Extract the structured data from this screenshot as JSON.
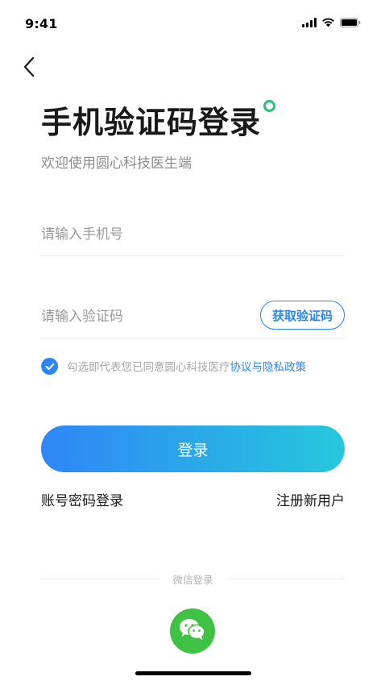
{
  "status_bar": {
    "time": "9:41"
  },
  "page": {
    "title": "手机验证码登录",
    "subtitle": "欢迎使用圆心科技医生端"
  },
  "form": {
    "phone_placeholder": "请输入手机号",
    "code_placeholder": "请输入验证码",
    "get_code_label": "获取验证码",
    "agreement_checked": true,
    "agreement_text": "勾选即代表您已同意圆心科技医疗",
    "agreement_link": "协议与隐私政策",
    "login_label": "登录"
  },
  "links": {
    "account_login": "账号密码登录",
    "register": "注册新用户"
  },
  "social": {
    "divider_label": "微信登录"
  },
  "colors": {
    "accent": "#2a86f5",
    "gradient_end": "#26c8dc",
    "brand_dot": "#27c07d",
    "wechat": "#3fc243"
  },
  "icons": [
    "back-arrow-icon",
    "signal-icon",
    "wifi-icon",
    "battery-icon",
    "check-icon",
    "wechat-icon"
  ]
}
